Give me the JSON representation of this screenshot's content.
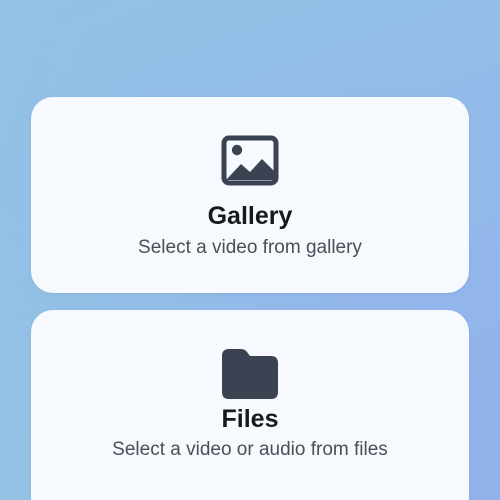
{
  "sources": [
    {
      "icon": "image-icon",
      "title": "Gallery",
      "subtitle": "Select a video from gallery"
    },
    {
      "icon": "folder-icon",
      "title": "Files",
      "subtitle": "Select a video or audio from files"
    }
  ],
  "colors": {
    "background_start": "#93c2e6",
    "background_end": "#91b0ec",
    "card": "#f6f9fd",
    "icon": "#3b4352",
    "title_text": "#161a20",
    "subtitle_text": "#4a4f57"
  }
}
